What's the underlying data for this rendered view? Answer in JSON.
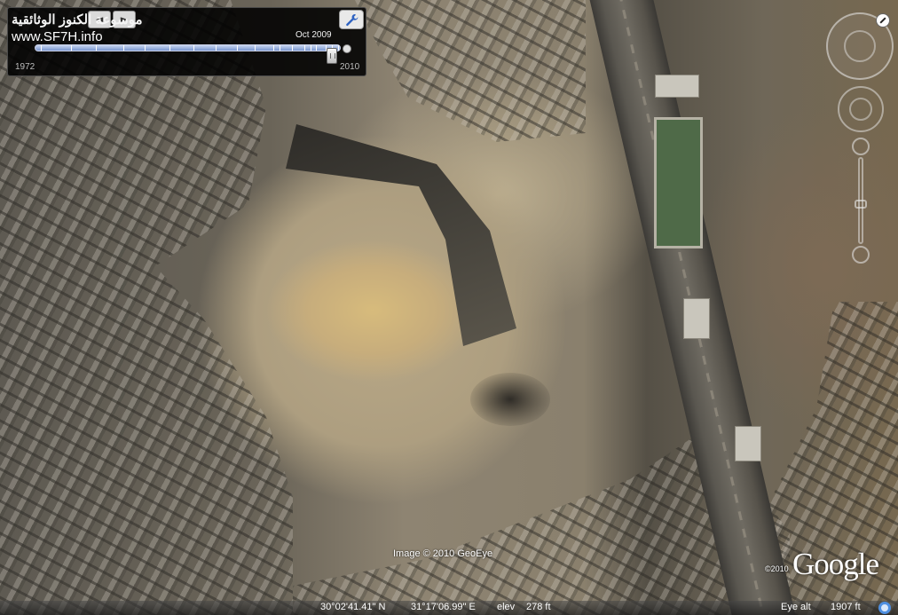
{
  "watermark": {
    "arabic_text": "موسوعة الكنوز الوثائقية",
    "url_text": "www.SF7H.info"
  },
  "time_slider": {
    "selected_date": "Oct 2009",
    "start_year": "1972",
    "end_year": "2010",
    "position_fraction": 0.97,
    "tick_fractions": [
      0.02,
      0.12,
      0.2,
      0.29,
      0.36,
      0.44,
      0.52,
      0.59,
      0.66,
      0.72,
      0.78,
      0.8,
      0.84,
      0.88,
      0.9,
      0.92,
      0.95,
      0.97,
      0.99
    ],
    "settings_icon": "wrench-icon",
    "accent_color": "#7a96d0"
  },
  "navigation": {
    "look_control": "compass-ring",
    "north_button_icon": "reset-north-icon",
    "zoom_level_fraction": 0.55
  },
  "map": {
    "imagery_attribution": "Image © 2010 GeoEye",
    "logo_year": "©2010",
    "logo_text": "Google"
  },
  "status_bar": {
    "latitude": "30°02'41.41\" N",
    "longitude": "31°17'06.99\" E",
    "elev_label": "elev",
    "elev_value": "278 ft",
    "eye_alt_label": "Eye alt",
    "eye_alt_value": "1907 ft",
    "stream_icon": "streaming-progress-icon"
  }
}
